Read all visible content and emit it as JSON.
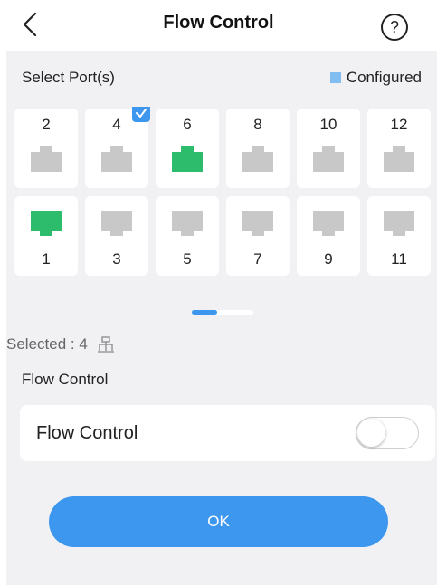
{
  "header": {
    "title": "Flow Control",
    "help_symbol": "?"
  },
  "ports": {
    "select_label": "Select Port(s)",
    "legend_label": "Configured",
    "legend_color": "#82bdf2",
    "top_row": [
      {
        "number": "2",
        "state": "idle",
        "checked": false
      },
      {
        "number": "4",
        "state": "idle",
        "checked": true
      },
      {
        "number": "6",
        "state": "active",
        "checked": false
      },
      {
        "number": "8",
        "state": "idle",
        "checked": false
      },
      {
        "number": "10",
        "state": "idle",
        "checked": false
      },
      {
        "number": "12",
        "state": "idle",
        "checked": false
      }
    ],
    "bottom_row": [
      {
        "number": "1",
        "state": "active",
        "checked": false
      },
      {
        "number": "3",
        "state": "idle",
        "checked": false
      },
      {
        "number": "5",
        "state": "idle",
        "checked": false
      },
      {
        "number": "7",
        "state": "idle",
        "checked": false
      },
      {
        "number": "9",
        "state": "idle",
        "checked": false
      },
      {
        "number": "11",
        "state": "idle",
        "checked": false
      }
    ]
  },
  "status": {
    "selected_text": "Selected : 4"
  },
  "flow_control": {
    "section_title": "Flow Control",
    "label": "Flow Control",
    "enabled": false
  },
  "actions": {
    "ok_label": "OK"
  },
  "colors": {
    "accent": "#3d97ee",
    "port_active": "#2dbb6c",
    "port_idle": "#c8c8c8"
  }
}
